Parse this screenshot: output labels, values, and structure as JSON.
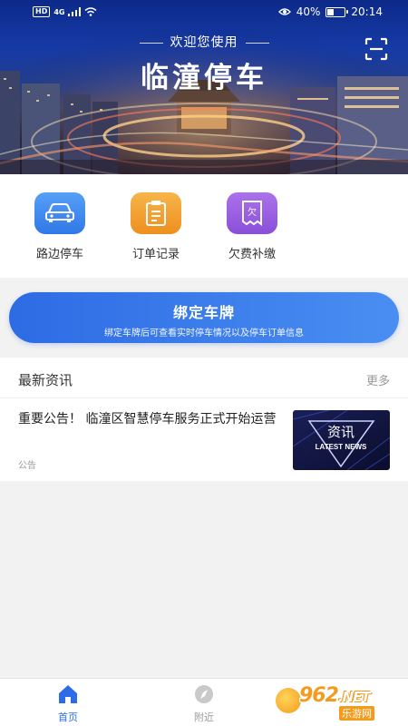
{
  "status_bar": {
    "hd": "HD",
    "network": "4G",
    "battery": "40%",
    "battery_level": 0.4,
    "time": "20:14"
  },
  "header": {
    "welcome": "欢迎您使用",
    "title": "临潼停车",
    "scan_icon": "scan-icon"
  },
  "quick_menu": [
    {
      "label": "路边停车",
      "icon": "car-icon",
      "color": "#3f8cf0"
    },
    {
      "label": "订单记录",
      "icon": "order-list-icon",
      "color": "#f3a12e"
    },
    {
      "label": "欠费补缴",
      "icon": "arrears-icon",
      "color": "#9c5ce0"
    }
  ],
  "bind_plate": {
    "title": "绑定车牌",
    "subtitle": "绑定车牌后可查看实时停车情况以及停车订单信息"
  },
  "news": {
    "section_title": "最新资讯",
    "more": "更多",
    "items": [
      {
        "title": "重要公告！ 临潼区智慧停车服务正式开始运营",
        "tag": "公告",
        "thumb_text": "资讯",
        "thumb_sub": "LATEST NEWS"
      }
    ]
  },
  "tabbar": {
    "tabs": [
      {
        "label": "首页",
        "icon": "home-icon",
        "active": true
      },
      {
        "label": "附近",
        "icon": "compass-icon",
        "active": false
      }
    ]
  },
  "watermark": {
    "brand": "962",
    "domain": ".NET",
    "site": "乐游网"
  },
  "colors": {
    "accent": "#2e6be6",
    "hero_top": "#0d2a8a",
    "background": "#f2f2f2"
  }
}
